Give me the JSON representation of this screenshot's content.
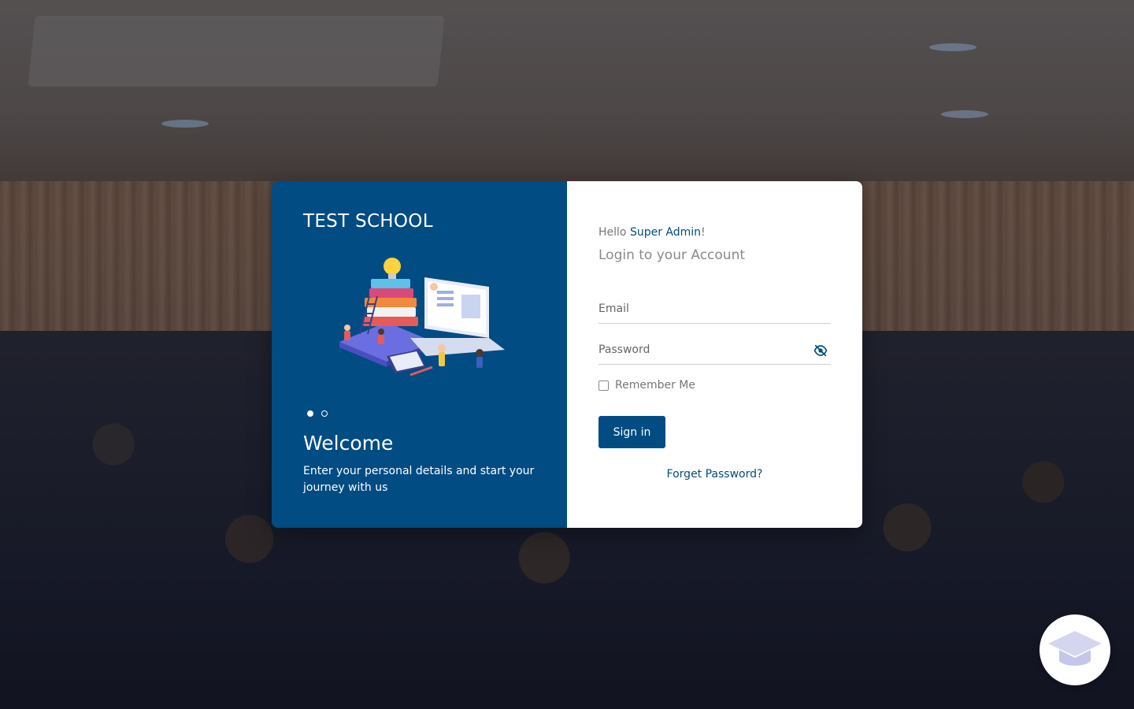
{
  "brand": {
    "school_name": "TEST SCHOOL",
    "primary_color": "#004c83"
  },
  "carousel": {
    "slide_count": 2,
    "active_index": 0,
    "title": "Welcome",
    "text": "Enter your personal details and start your journey with us",
    "image_icon": "education-illustration"
  },
  "login": {
    "greeting_prefix": "Hello ",
    "greeting_name": "Super Admin",
    "greeting_suffix": "!",
    "subtitle": "Login to your Account",
    "email_placeholder": "Email",
    "email_value": "",
    "password_placeholder": "Password",
    "password_value": "",
    "password_toggle_icon": "eye-slash-icon",
    "remember_label": "Remember Me",
    "remember_checked": false,
    "signin_label": "Sign in",
    "forgot_label": "Forget Password?"
  },
  "fab": {
    "icon": "graduation-cap-icon"
  }
}
